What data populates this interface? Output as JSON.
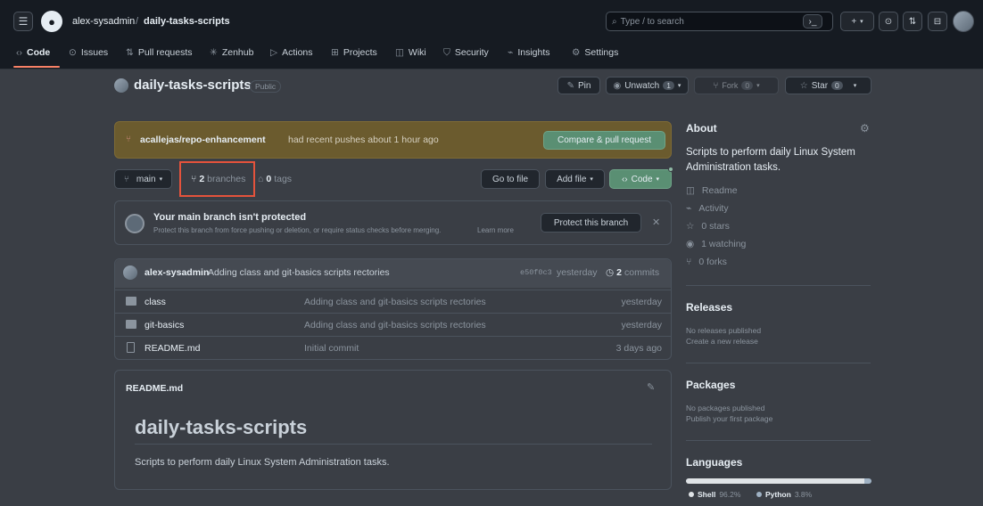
{
  "header": {
    "owner": "alex-sysadmin",
    "separator": "/",
    "repo": "daily-tasks-scripts",
    "search_placeholder": "Type / to search",
    "tabs": [
      {
        "label": "Code",
        "icon": "code-icon"
      },
      {
        "label": "Issues",
        "icon": "issue-icon"
      },
      {
        "label": "Pull requests",
        "icon": "pull-request-icon"
      },
      {
        "label": "Zenhub",
        "icon": "zenhub-icon"
      },
      {
        "label": "Actions",
        "icon": "play-icon"
      },
      {
        "label": "Projects",
        "icon": "table-icon"
      },
      {
        "label": "Wiki",
        "icon": "book-icon"
      },
      {
        "label": "Security",
        "icon": "shield-icon"
      },
      {
        "label": "Insights",
        "icon": "graph-icon"
      },
      {
        "label": "Settings",
        "icon": "gear-icon"
      }
    ]
  },
  "repo_header": {
    "name": "daily-tasks-scripts",
    "visibility": "Public",
    "pin_label": "Pin",
    "unwatch_label": "Unwatch",
    "unwatch_count": "1",
    "fork_label": "Fork",
    "fork_count": "0",
    "star_label": "Star",
    "star_count": "0"
  },
  "push_banner": {
    "branch": "acallejas/repo-enhancement",
    "message": "had recent pushes about 1 hour ago",
    "button": "Compare & pull request"
  },
  "branch_bar": {
    "branch": "main",
    "branches_count": "2",
    "branches_label": "branches",
    "tags_count": "0",
    "tags_label": "tags",
    "go_to_file": "Go to file",
    "add_file": "Add file",
    "code": "Code"
  },
  "protect": {
    "title": "Your main branch isn't protected",
    "desc": "Protect this branch from force pushing or deletion, or require status checks before merging.",
    "learn_more": "Learn more",
    "button": "Protect this branch"
  },
  "commit": {
    "author": "alex-sysadmin",
    "message": "Adding class and git-basics scripts rectories",
    "sha": "e50f0c3",
    "time": "yesterday",
    "commits_count": "2",
    "commits_label": "commits"
  },
  "files": [
    {
      "name": "class",
      "type": "folder",
      "message": "Adding class and git-basics scripts rectories",
      "time": "yesterday"
    },
    {
      "name": "git-basics",
      "type": "folder",
      "message": "Adding class and git-basics scripts rectories",
      "time": "yesterday"
    },
    {
      "name": "README.md",
      "type": "file",
      "message": "Initial commit",
      "time": "3 days ago"
    }
  ],
  "readme": {
    "filename": "README.md",
    "heading": "daily-tasks-scripts",
    "body": "Scripts to perform daily Linux System Administration tasks."
  },
  "about": {
    "title": "About",
    "description": "Scripts to perform daily Linux System Administration tasks.",
    "links": [
      {
        "label": "Readme",
        "icon": "book-icon"
      },
      {
        "label": "Activity",
        "icon": "pulse-icon"
      },
      {
        "label": "0 stars",
        "icon": "star-icon"
      },
      {
        "label": "1 watching",
        "icon": "eye-icon"
      },
      {
        "label": "0 forks",
        "icon": "fork-icon"
      }
    ]
  },
  "releases": {
    "title": "Releases",
    "none": "No releases published",
    "create": "Create a new release"
  },
  "packages": {
    "title": "Packages",
    "none": "No packages published",
    "publish": "Publish your first package"
  },
  "languages": {
    "title": "Languages",
    "items": [
      {
        "name": "Shell",
        "percent": "96.2%",
        "value": 96.2,
        "color": "#89e051"
      },
      {
        "name": "Python",
        "percent": "3.8%",
        "value": 3.8,
        "color": "#3572a5"
      }
    ]
  },
  "colors": {
    "accent": "#238636",
    "highlight_box": "#e5533c",
    "banner": "#6b5b2e"
  }
}
